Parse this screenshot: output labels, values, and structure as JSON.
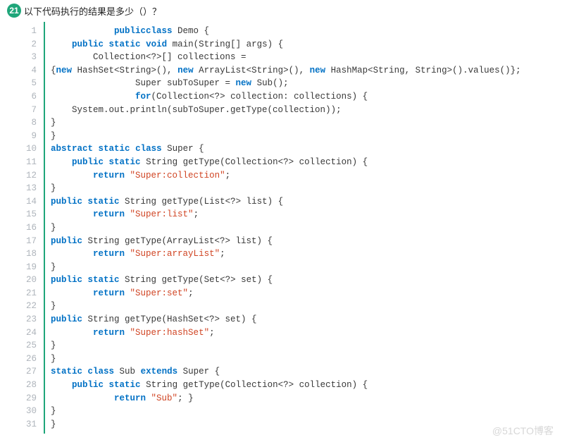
{
  "question": {
    "number": "21",
    "text": "以下代码执行的结果是多少（）？"
  },
  "code": {
    "lines": [
      [
        [
          "            "
        ],
        [
          "kw",
          "public"
        ],
        [
          " ",
          ""
        ],
        [
          "kw",
          "class"
        ],
        [
          " Demo {"
        ]
      ],
      [
        [
          "    "
        ],
        [
          "kw",
          "public"
        ],
        [
          " "
        ],
        [
          "kw",
          "static"
        ],
        [
          " "
        ],
        [
          "kw",
          "void"
        ],
        [
          " main(String[] args) {"
        ]
      ],
      [
        [
          "        Collection<?>[] collections ="
        ]
      ],
      [
        [
          "{"
        ],
        [
          "kw2",
          "new"
        ],
        [
          " HashSet<String>(), "
        ],
        [
          "kw2",
          "new"
        ],
        [
          " ArrayList<String>(), "
        ],
        [
          "kw2",
          "new"
        ],
        [
          " HashMap<String, String>().values()};"
        ]
      ],
      [
        [
          "                Super subToSuper = "
        ],
        [
          "kw2",
          "new"
        ],
        [
          " Sub();"
        ]
      ],
      [
        [
          "                "
        ],
        [
          "kw",
          "for"
        ],
        [
          "(Collection<?> collection: collections) {"
        ]
      ],
      [
        [
          "    System.out.println(subToSuper.getType(collection));"
        ]
      ],
      [
        [
          "}"
        ]
      ],
      [
        [
          "}"
        ]
      ],
      [
        [
          ""
        ],
        [
          "kw",
          "abstract"
        ],
        [
          " "
        ],
        [
          "kw",
          "static"
        ],
        [
          " "
        ],
        [
          "kw",
          "class"
        ],
        [
          " Super {"
        ]
      ],
      [
        [
          "    "
        ],
        [
          "kw",
          "public"
        ],
        [
          " "
        ],
        [
          "kw",
          "static"
        ],
        [
          " String getType(Collection<?> collection) {"
        ]
      ],
      [
        [
          "        "
        ],
        [
          "kw",
          "return"
        ],
        [
          " "
        ],
        [
          "str",
          "\"Super:collection\""
        ],
        [
          ";"
        ]
      ],
      [
        [
          "}"
        ]
      ],
      [
        [
          ""
        ],
        [
          "kw",
          "public"
        ],
        [
          " "
        ],
        [
          "kw",
          "static"
        ],
        [
          " String getType(List<?> list) {"
        ]
      ],
      [
        [
          "        "
        ],
        [
          "kw",
          "return"
        ],
        [
          " "
        ],
        [
          "str",
          "\"Super:list\""
        ],
        [
          ";"
        ]
      ],
      [
        [
          "}"
        ]
      ],
      [
        [
          ""
        ],
        [
          "kw",
          "public"
        ],
        [
          " String getType(ArrayList<?> list) {"
        ]
      ],
      [
        [
          "        "
        ],
        [
          "kw",
          "return"
        ],
        [
          " "
        ],
        [
          "str",
          "\"Super:arrayList\""
        ],
        [
          ";"
        ]
      ],
      [
        [
          "}"
        ]
      ],
      [
        [
          ""
        ],
        [
          "kw",
          "public"
        ],
        [
          " "
        ],
        [
          "kw",
          "static"
        ],
        [
          " String getType(Set<?> set) {"
        ]
      ],
      [
        [
          "        "
        ],
        [
          "kw",
          "return"
        ],
        [
          " "
        ],
        [
          "str",
          "\"Super:set\""
        ],
        [
          ";"
        ]
      ],
      [
        [
          "}"
        ]
      ],
      [
        [
          ""
        ],
        [
          "kw",
          "public"
        ],
        [
          " String getType(HashSet<?> set) {"
        ]
      ],
      [
        [
          "        "
        ],
        [
          "kw",
          "return"
        ],
        [
          " "
        ],
        [
          "str",
          "\"Super:hashSet\""
        ],
        [
          ";"
        ]
      ],
      [
        [
          "}"
        ]
      ],
      [
        [
          "}"
        ]
      ],
      [
        [
          ""
        ],
        [
          "kw",
          "static"
        ],
        [
          " "
        ],
        [
          "kw",
          "class"
        ],
        [
          " Sub "
        ],
        [
          "kw",
          "extends"
        ],
        [
          " Super {"
        ]
      ],
      [
        [
          "    "
        ],
        [
          "kw",
          "public"
        ],
        [
          " "
        ],
        [
          "kw",
          "static"
        ],
        [
          " String getType(Collection<?> collection) {"
        ]
      ],
      [
        [
          "            "
        ],
        [
          "kw",
          "return"
        ],
        [
          " "
        ],
        [
          "str",
          "\"Sub\""
        ],
        [
          "; }"
        ]
      ],
      [
        [
          "}"
        ]
      ],
      [
        [
          "}"
        ]
      ]
    ]
  },
  "watermark": "@51CTO博客"
}
